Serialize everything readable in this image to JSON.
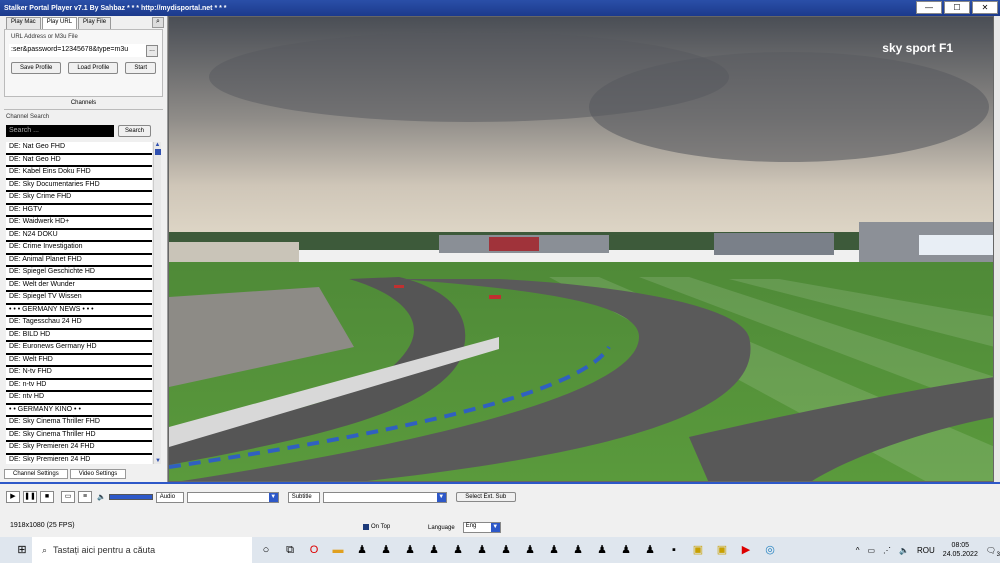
{
  "window": {
    "title": "Stalker Portal Player v7.1 By Sahbaz  * * * http://mydisportal.net * * *",
    "minimize": "—",
    "maximize": "☐",
    "close": "✕"
  },
  "tabs": [
    "Play Mac",
    "Play URL",
    "Play File"
  ],
  "url_section": {
    "label": "URL Address or M3u File",
    "value": ":ser&password=12345678&type=m3u",
    "browse": "...",
    "save_profile": "Save Profile",
    "load_profile": "Load Profile",
    "start": "Start"
  },
  "channels_header": "Channels",
  "search": {
    "label": "Channel Search",
    "placeholder": "Search ...",
    "button": "Search"
  },
  "channels": [
    "DE: Nat Geo FHD",
    "DE: Nat Geo HD",
    "DE: Kabel Eins Doku FHD",
    "DE: Sky Documentaries FHD",
    "DE: Sky Crime FHD",
    "DE: HGTV",
    "DE: Waidwerk HD+",
    "DE: N24 DOKU",
    "DE: Crime Investigation",
    "DE: Animal Planet FHD",
    "DE: Spiegel Geschichte HD",
    "DE: Welt der Wunder",
    "DE: Spiegel TV Wissen",
    "• • • GERMANY NEWS • • •",
    "DE: Tagesschau 24 HD",
    "DE: BILD HD",
    "DE: Euronews Germany HD",
    "DE: Welt FHD",
    "DE: N-tv FHD",
    "DE: n-tv HD",
    "DE: ntv HD",
    "• • GERMANY KINO • •",
    "DE: Sky Cinema Thriller FHD",
    "DE: Sky Cinema Thriller HD",
    "DE: Sky Premieren 24 FHD",
    "DE: Sky Premieren 24 HD"
  ],
  "bottom_tabs": [
    "Channel Settings",
    "Video Settings"
  ],
  "video": {
    "logo": "sky sport F1"
  },
  "controls": {
    "audio_label": "Audio",
    "subtitle_label": "Subtitle",
    "select_ext_sub": "Select Ext. Sub",
    "resolution": "1918x1080  (25 FPS)",
    "on_top": "On Top",
    "language_label": "Language",
    "language_value": "Eng"
  },
  "taskbar": {
    "search_placeholder": "Tastați aici pentru a căuta",
    "language": "ROU",
    "time": "08:05",
    "date": "24.05.2022",
    "notification_count": "3"
  }
}
